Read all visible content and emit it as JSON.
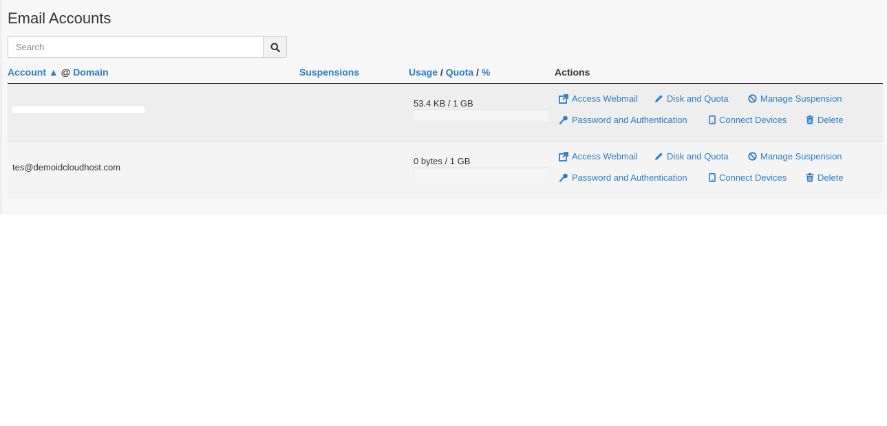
{
  "page": {
    "title": "Email Accounts"
  },
  "search": {
    "placeholder": "Search",
    "value": ""
  },
  "table": {
    "headers": {
      "account": "Account",
      "sort_indicator": "▲",
      "at": "@",
      "domain": "Domain",
      "suspensions": "Suspensions",
      "usage": "Usage",
      "quota": "Quota",
      "percent": "%",
      "slash": "/",
      "actions": "Actions"
    },
    "rows": [
      {
        "account": "",
        "usage_text": "53.4 KB / 1 GB",
        "usage_fraction": 0.0001
      },
      {
        "account": "tes@demoidcloudhost.com",
        "usage_text": "0 bytes / 1 GB",
        "usage_fraction": 0
      }
    ],
    "actions": {
      "access_webmail": "Access Webmail",
      "disk_and_quota": "Disk and Quota",
      "manage_suspension": "Manage Suspension",
      "password_and_authentication": "Password and Authentication",
      "connect_devices": "Connect Devices",
      "delete": "Delete"
    }
  },
  "colors": {
    "link": "#2d7dc2",
    "text": "#333333",
    "panel_bg": "#f7f7f7"
  }
}
